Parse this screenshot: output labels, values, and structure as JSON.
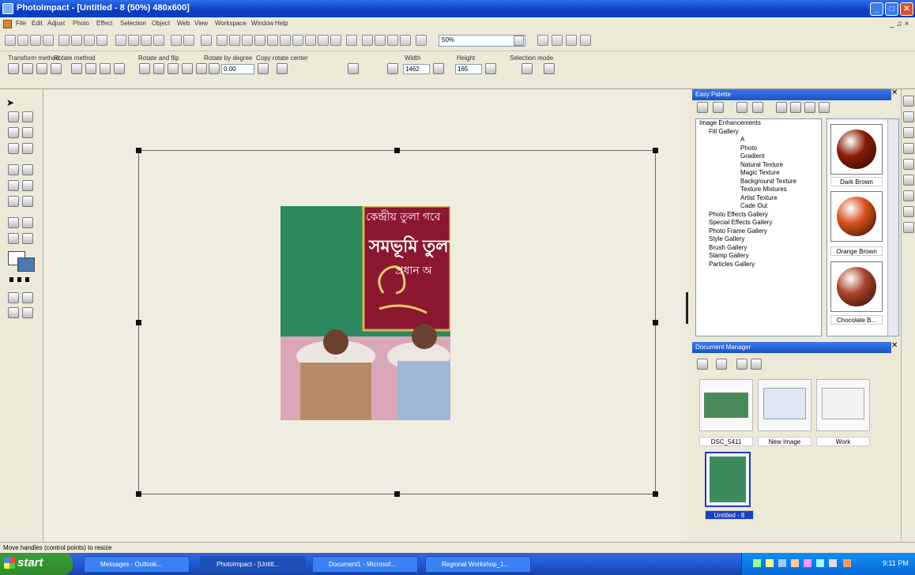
{
  "window": {
    "title": "PhotoImpact - [Untitled - 8 (50%) 480x600]",
    "buttons": [
      "_",
      "□",
      "✕"
    ]
  },
  "menu": {
    "items": [
      "File",
      "Edit",
      "Adjust",
      "Photo",
      "Effect",
      "Selection",
      "Object",
      "Web",
      "View",
      "Workspace",
      "Window",
      "Help"
    ]
  },
  "toolbar": {
    "zoom": "50%"
  },
  "attributes": {
    "transform_method": "Transform method",
    "rotate_method": "Rotate method",
    "rotate_flip": "Rotate and flip",
    "rotate_by_degree": "Rotate by degree",
    "copy_rotate_center": "Copy rotate center",
    "width_label": "Width",
    "height_label": "Height",
    "selection_mode": "Selection mode",
    "degree_value": "0.00",
    "width_value": "1462",
    "height_value": "165"
  },
  "easy_palette": {
    "title": "Easy Palette",
    "tree": [
      "Image Enhancements",
      "Fill Gallery",
      "A",
      "Photo",
      "Gradient",
      "Natural Texture",
      "Magic Texture",
      "Background Texture",
      "Texture Mixtures",
      "Artist Texture",
      "Cade Out",
      "Photo Effects Gallery",
      "Special Effects Gallery",
      "Photo Frame Gallery",
      "Style Gallery",
      "Brush Gallery",
      "Stamp Gallery",
      "Particles Gallery"
    ],
    "swatches": [
      {
        "name": "Dark Brown",
        "color": "#8a1e06"
      },
      {
        "name": "Orange Brown",
        "color": "#d8531f"
      },
      {
        "name": "Chocolate B...",
        "color": "#a9442a"
      }
    ]
  },
  "document_manager": {
    "title": "Document Manager",
    "docs": [
      "DSC_5411",
      "New Image",
      "Work",
      "Untitled - 8"
    ]
  },
  "status": {
    "text": "Move handles (control points) to resize"
  },
  "taskbar": {
    "start": "start",
    "tasks": [
      "Messages - Outlook...",
      "PhotoImpact - [Untitl...",
      "Document1 - Microsof...",
      "Regional Workshop_1..."
    ],
    "clock": "9:11 PM"
  },
  "photo": {
    "banner_lines": [
      "কেন্দ্রীয় তুলা গবে",
      "সমভূমি তুলা",
      "প্রধান অ"
    ]
  }
}
